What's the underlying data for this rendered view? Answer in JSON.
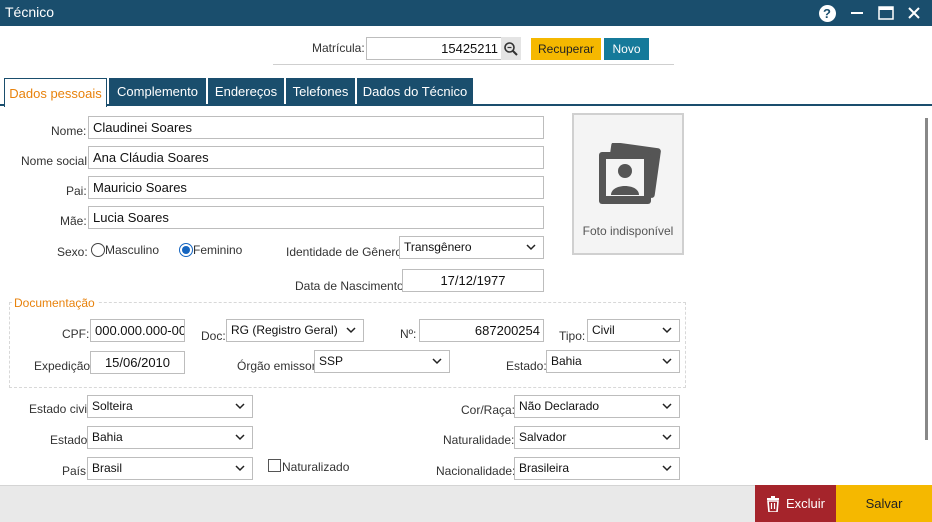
{
  "window": {
    "title": "Técnico"
  },
  "colors": {
    "titlebar": "#1a4e6d",
    "accent": "#e8820c",
    "primary": "#f5b800",
    "danger": "#a5242b",
    "novo": "#157a9a"
  },
  "header": {
    "matricula_label": "Matrícula:",
    "matricula_value": "15425211",
    "recuperar_label": "Recuperar",
    "novo_label": "Novo"
  },
  "tabs": [
    {
      "label": "Dados pessoais",
      "active": true
    },
    {
      "label": "Complemento"
    },
    {
      "label": "Endereços"
    },
    {
      "label": "Telefones"
    },
    {
      "label": "Dados do Técnico"
    }
  ],
  "pessoais": {
    "nome_label": "Nome:",
    "nome_value": "Claudinei Soares",
    "nome_social_label": "Nome social:",
    "nome_social_value": "Ana Cláudia Soares",
    "pai_label": "Pai:",
    "pai_value": "Mauricio Soares",
    "mae_label": "Mãe:",
    "mae_value": "Lucia Soares",
    "sexo_label": "Sexo:",
    "sexo_masculino": "Masculino",
    "sexo_feminino": "Feminino",
    "sexo_selected": "Feminino",
    "identidade_label": "Identidade de Gênero:",
    "identidade_value": "Transgênero",
    "nascimento_label": "Data de Nascimento:",
    "nascimento_value": "17/12/1977",
    "foto_caption": "Foto indisponível"
  },
  "documentacao": {
    "legend": "Documentação",
    "cpf_label": "CPF:",
    "cpf_value": "000.000.000-00",
    "doc_label": "Doc:",
    "doc_value": "RG (Registro Geral)",
    "numero_label": "Nº:",
    "numero_value": "687200254",
    "tipo_label": "Tipo:",
    "tipo_value": "Civil",
    "expedicao_label": "Expedição:",
    "expedicao_value": "15/06/2010",
    "orgao_label": "Órgão emissor:",
    "orgao_value": "SSP",
    "estado_label": "Estado:",
    "estado_value": "Bahia"
  },
  "outros": {
    "estado_civil_label": "Estado civil:",
    "estado_civil_value": "Solteira",
    "cor_label": "Cor/Raça:",
    "cor_value": "Não Declarado",
    "estado_label": "Estado:",
    "estado_value": "Bahia",
    "naturalidade_label": "Naturalidade:",
    "naturalidade_value": "Salvador",
    "pais_label": "País:",
    "pais_value": "Brasil",
    "naturalizado_label": "Naturalizado",
    "nacionalidade_label": "Nacionalidade:",
    "nacionalidade_value": "Brasileira"
  },
  "footer": {
    "excluir_label": "Excluir",
    "salvar_label": "Salvar"
  }
}
